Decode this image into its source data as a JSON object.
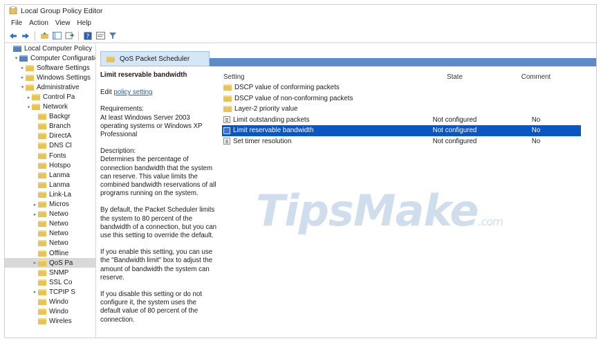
{
  "window": {
    "title": "Local Group Policy Editor"
  },
  "menu": [
    "File",
    "Action",
    "View",
    "Help"
  ],
  "toolbar": [
    "back-icon",
    "forward-icon",
    "up-folder-icon",
    "show-hide-tree-icon",
    "export-list-icon",
    "help-icon",
    "properties-icon",
    "filter-icon"
  ],
  "tree": [
    {
      "label": "Local Computer Policy",
      "level": 0,
      "arrow": "",
      "icon": "blue"
    },
    {
      "label": "Computer Configuration",
      "level": 1,
      "arrow": "⌄",
      "icon": "blue"
    },
    {
      "label": "Software Settings",
      "level": 2,
      "arrow": "›",
      "icon": "folder"
    },
    {
      "label": "Windows Settings",
      "level": 2,
      "arrow": "›",
      "icon": "folder"
    },
    {
      "label": "Administrative",
      "level": 2,
      "arrow": "⌄",
      "icon": "folder"
    },
    {
      "label": "Control Pa",
      "level": 3,
      "arrow": "›",
      "icon": "folder"
    },
    {
      "label": "Network",
      "level": 3,
      "arrow": "⌄",
      "icon": "folder"
    },
    {
      "label": "Backgr",
      "level": 4,
      "arrow": "",
      "icon": "folder"
    },
    {
      "label": "Branch",
      "level": 4,
      "arrow": "",
      "icon": "folder"
    },
    {
      "label": "DirectA",
      "level": 4,
      "arrow": "",
      "icon": "folder"
    },
    {
      "label": "DNS Cl",
      "level": 4,
      "arrow": "",
      "icon": "folder"
    },
    {
      "label": "Fonts",
      "level": 4,
      "arrow": "",
      "icon": "folder"
    },
    {
      "label": "Hotspo",
      "level": 4,
      "arrow": "",
      "icon": "folder"
    },
    {
      "label": "Lanma",
      "level": 4,
      "arrow": "",
      "icon": "folder"
    },
    {
      "label": "Lanma",
      "level": 4,
      "arrow": "",
      "icon": "folder"
    },
    {
      "label": "Link-La",
      "level": 4,
      "arrow": "",
      "icon": "folder"
    },
    {
      "label": "Micros",
      "level": 4,
      "arrow": "›",
      "icon": "folder"
    },
    {
      "label": "Netwo",
      "level": 4,
      "arrow": "›",
      "icon": "folder"
    },
    {
      "label": "Netwo",
      "level": 4,
      "arrow": "",
      "icon": "folder"
    },
    {
      "label": "Netwo",
      "level": 4,
      "arrow": "",
      "icon": "folder"
    },
    {
      "label": "Netwo",
      "level": 4,
      "arrow": "",
      "icon": "folder"
    },
    {
      "label": "Offline",
      "level": 4,
      "arrow": "",
      "icon": "folder"
    },
    {
      "label": "QoS Pa",
      "level": 4,
      "arrow": "›",
      "icon": "folder",
      "selected": true
    },
    {
      "label": "SNMP",
      "level": 4,
      "arrow": "",
      "icon": "folder"
    },
    {
      "label": "SSL Co",
      "level": 4,
      "arrow": "",
      "icon": "folder"
    },
    {
      "label": "TCPIP S",
      "level": 4,
      "arrow": "›",
      "icon": "folder"
    },
    {
      "label": "Windo",
      "level": 4,
      "arrow": "",
      "icon": "folder"
    },
    {
      "label": "Windo",
      "level": 4,
      "arrow": "",
      "icon": "folder"
    },
    {
      "label": "Wireles",
      "level": 4,
      "arrow": "",
      "icon": "folder"
    }
  ],
  "tab": {
    "label": "QoS Packet Scheduler"
  },
  "description": {
    "heading": "Limit reservable bandwidth",
    "edit_prefix": "Edit ",
    "edit_link": "policy setting",
    "requirements_label": "Requirements:",
    "requirements": "At least Windows Server 2003 operating systems or Windows XP Professional",
    "description_label": "Description:",
    "paragraphs": [
      "Determines the percentage of connection bandwidth that the system can reserve. This value limits the combined bandwidth reservations of all programs running on the system.",
      "By default, the Packet Scheduler limits the system to 80 percent of the bandwidth of a connection, but you can use this setting to override the default.",
      "If you enable this setting, you can use the \"Bandwidth limit\" box to adjust the amount of bandwidth the system can reserve.",
      "If you disable this setting or do not configure it, the system uses the default value of 80 percent of the connection."
    ]
  },
  "grid": {
    "columns": [
      "Setting",
      "State",
      "Comment"
    ],
    "rows": [
      {
        "type": "folder",
        "name": "DSCP value of conforming packets",
        "state": "",
        "comment": ""
      },
      {
        "type": "folder",
        "name": "DSCP value of non-conforming packets",
        "state": "",
        "comment": ""
      },
      {
        "type": "folder",
        "name": "Layer-2 priority value",
        "state": "",
        "comment": ""
      },
      {
        "type": "setting",
        "name": "Limit outstanding packets",
        "state": "Not configured",
        "comment": "No"
      },
      {
        "type": "setting",
        "name": "Limit reservable bandwidth",
        "state": "Not configured",
        "comment": "No",
        "selected": true
      },
      {
        "type": "setting",
        "name": "Set timer resolution",
        "state": "Not configured",
        "comment": "No"
      }
    ]
  },
  "watermark": {
    "main": "TipsMake",
    "suffix": ".com"
  }
}
